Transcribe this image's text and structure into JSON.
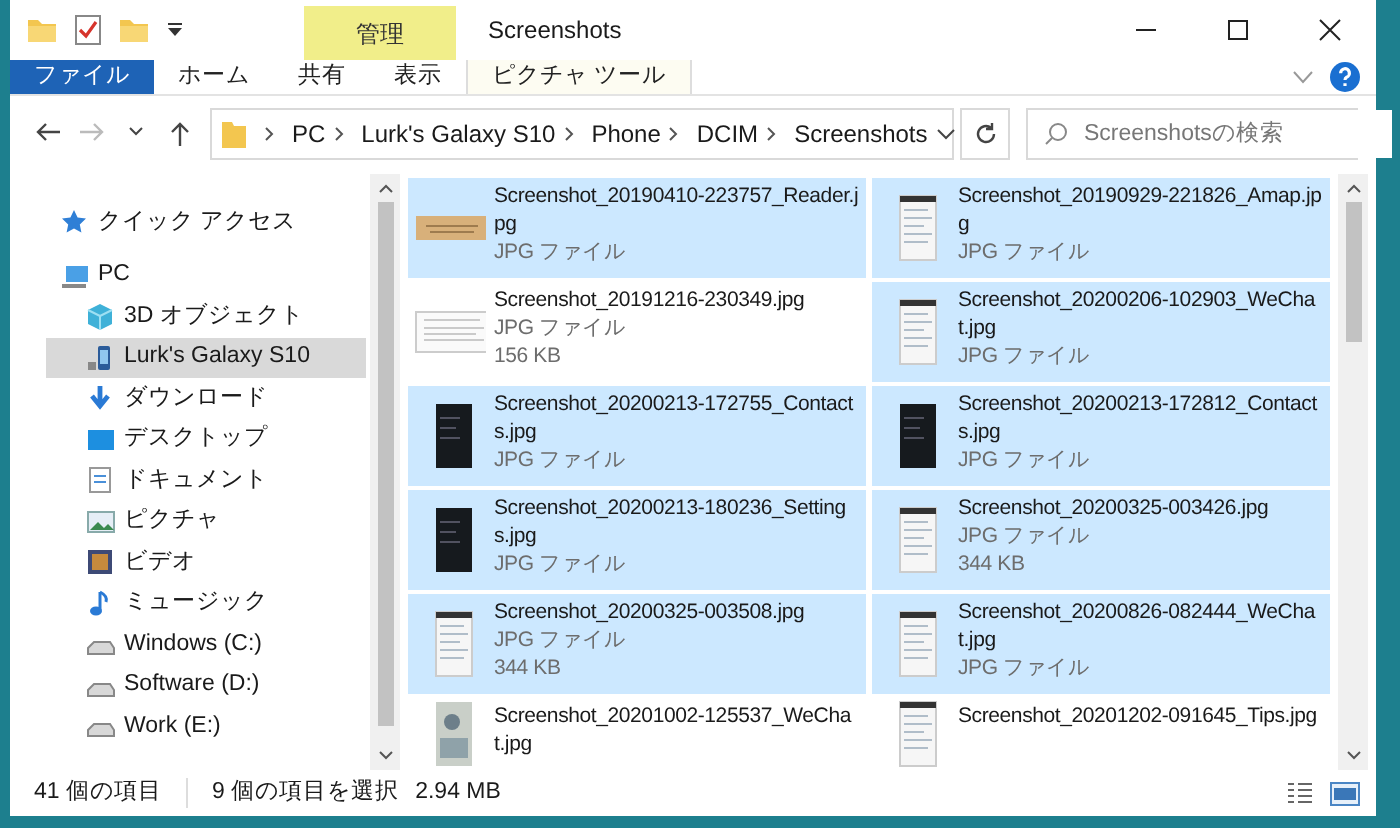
{
  "window": {
    "title": "Screenshots",
    "context_tab": "管理"
  },
  "ribbon": {
    "tabs": [
      {
        "label": "ファイル",
        "kind": "file"
      },
      {
        "label": "ホーム",
        "kind": "plain"
      },
      {
        "label": "共有",
        "kind": "plain"
      },
      {
        "label": "表示",
        "kind": "plain"
      },
      {
        "label": "ピクチャ ツール",
        "kind": "context"
      }
    ]
  },
  "address": {
    "breadcrumb": [
      "PC",
      "Lurk's Galaxy S10",
      "Phone",
      "DCIM",
      "Screenshots"
    ]
  },
  "search": {
    "placeholder": "Screenshotsの検索"
  },
  "sidebar": {
    "items": [
      {
        "label": "クイック アクセス",
        "kind": "star",
        "selected": false
      },
      {
        "label": "PC",
        "kind": "pc",
        "selected": false,
        "children": [
          {
            "label": "3D オブジェクト",
            "kind": "cube",
            "selected": false
          },
          {
            "label": "Lurk's Galaxy S10",
            "kind": "phone",
            "selected": true
          },
          {
            "label": "ダウンロード",
            "kind": "download",
            "selected": false
          },
          {
            "label": "デスクトップ",
            "kind": "desktop",
            "selected": false
          },
          {
            "label": "ドキュメント",
            "kind": "document",
            "selected": false
          },
          {
            "label": "ピクチャ",
            "kind": "picture",
            "selected": false
          },
          {
            "label": "ビデオ",
            "kind": "video",
            "selected": false
          },
          {
            "label": "ミュージック",
            "kind": "music",
            "selected": false
          },
          {
            "label": "Windows (C:)",
            "kind": "drive",
            "selected": false
          },
          {
            "label": "Software (D:)",
            "kind": "drive",
            "selected": false
          },
          {
            "label": "Work (E:)",
            "kind": "drive",
            "selected": false
          }
        ]
      }
    ]
  },
  "files": [
    {
      "name": "Screenshot_20190410-223757_Reader.jpg",
      "type": "JPG ファイル",
      "selected": true,
      "kind": "wide"
    },
    {
      "name": "Screenshot_20190929-221826_Amap.jpg",
      "type": "JPG ファイル",
      "selected": true,
      "kind": "light"
    },
    {
      "name": "Screenshot_20191216-230349.jpg",
      "type": "JPG ファイル",
      "size": "156 KB",
      "selected": false,
      "kind": "page"
    },
    {
      "name": "Screenshot_20200206-102903_WeChat.jpg",
      "type": "JPG ファイル",
      "selected": true,
      "kind": "light"
    },
    {
      "name": "Screenshot_20200213-172755_Contacts.jpg",
      "type": "JPG ファイル",
      "selected": true,
      "kind": "dark"
    },
    {
      "name": "Screenshot_20200213-172812_Contacts.jpg",
      "type": "JPG ファイル",
      "selected": true,
      "kind": "dark"
    },
    {
      "name": "Screenshot_20200213-180236_Settings.jpg",
      "type": "JPG ファイル",
      "selected": true,
      "kind": "dark"
    },
    {
      "name": "Screenshot_20200325-003426.jpg",
      "type": "JPG ファイル",
      "size": "344 KB",
      "selected": true,
      "kind": "light"
    },
    {
      "name": "Screenshot_20200325-003508.jpg",
      "type": "JPG ファイル",
      "size": "344 KB",
      "selected": true,
      "kind": "light"
    },
    {
      "name": "Screenshot_20200826-082444_WeChat.jpg",
      "type": "JPG ファイル",
      "selected": true,
      "kind": "light"
    },
    {
      "name": "Screenshot_20201002-125537_WeChat.jpg",
      "selected": false,
      "kind": "photo"
    },
    {
      "name": "Screenshot_20201202-091645_Tips.jpg",
      "selected": false,
      "kind": "light"
    }
  ],
  "status_bar": {
    "item_count": "41 個の項目",
    "selection": "9 個の項目を選択",
    "selection_size": "2.94 MB"
  }
}
